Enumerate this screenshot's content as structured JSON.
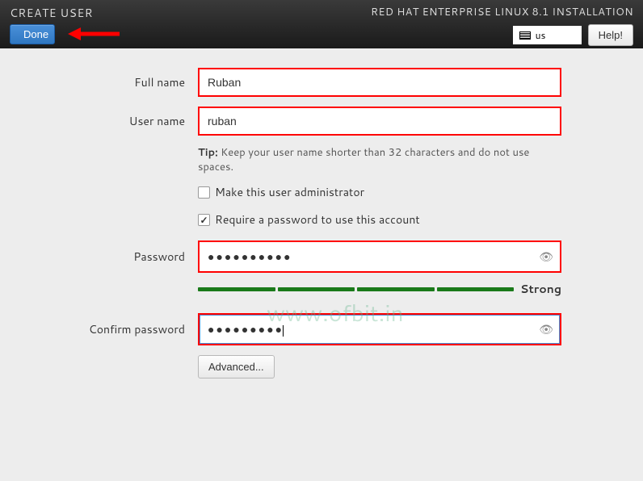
{
  "header": {
    "title": "CREATE USER",
    "done_label": "Done",
    "product": "RED HAT ENTERPRISE LINUX 8.1 INSTALLATION",
    "keyboard_layout": "us",
    "help_label": "Help!"
  },
  "form": {
    "full_name_label": "Full name",
    "full_name_value": "Ruban",
    "user_name_label": "User name",
    "user_name_value": "ruban",
    "tip_prefix": "Tip:",
    "tip_text": " Keep your user name shorter than 32 characters and do not use spaces.",
    "admin_checkbox_label": "Make this user administrator",
    "admin_checked": false,
    "require_pw_label": "Require a password to use this account",
    "require_pw_checked": true,
    "password_label": "Password",
    "password_value": "●●●●●●●●●●",
    "strength_label": "Strong",
    "confirm_label": "Confirm password",
    "confirm_value": "●●●●●●●●●",
    "advanced_label": "Advanced..."
  },
  "watermark": "www.ofbit.in"
}
